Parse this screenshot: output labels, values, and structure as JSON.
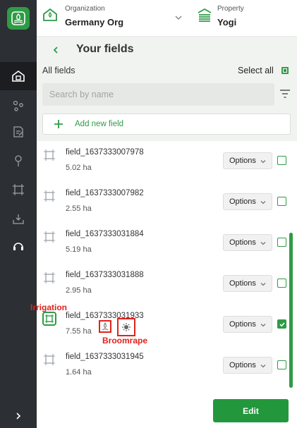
{
  "header": {
    "org_label": "Organization",
    "org_name": "Germany Org",
    "property_label": "Property",
    "property_name": "Yogi"
  },
  "panel": {
    "title": "Your fields",
    "all_fields": "All fields",
    "select_all": "Select all",
    "search_placeholder": "Search by name",
    "add_field": "Add new field"
  },
  "fields": [
    {
      "name": "field_1637333007978",
      "area": "5.02 ha",
      "options": "Options",
      "checked": false
    },
    {
      "name": "field_1637333007982",
      "area": "2.55 ha",
      "options": "Options",
      "checked": false
    },
    {
      "name": "field_1637333031884",
      "area": "5.19 ha",
      "options": "Options",
      "checked": false
    },
    {
      "name": "field_1637333031888",
      "area": "2.95 ha",
      "options": "Options",
      "checked": false
    },
    {
      "name": "field_1637333031933",
      "area": "7.55 ha",
      "options": "Options",
      "checked": true
    },
    {
      "name": "field_1637333031945",
      "area": "1.64 ha",
      "options": "Options",
      "checked": false
    }
  ],
  "annotations": {
    "irrigation": "Irrigation",
    "broomrape": "Broomrape"
  },
  "footer": {
    "edit": "Edit"
  },
  "colors": {
    "accent": "#2e9b45",
    "rail": "#2c2f33",
    "annotation": "#e0221c"
  }
}
